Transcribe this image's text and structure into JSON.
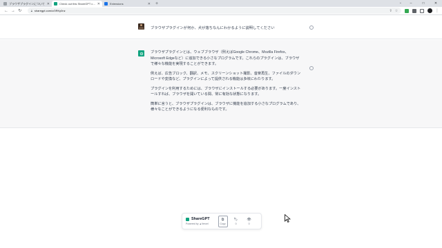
{
  "browser": {
    "tabs": [
      {
        "label": "ブラウザプラグインについて",
        "favicon_color": "#9aa0a6",
        "active": false
      },
      {
        "label": "Check out this ShareGPT conversation",
        "favicon_color": "#10a37f",
        "active": true
      },
      {
        "label": "Extensions",
        "favicon_color": "#1a73e8",
        "active": false
      }
    ],
    "new_tab_glyph": "+",
    "url": "sharegpt.com/c/0RKy0nz",
    "window_controls": [
      "–",
      "□",
      "✕"
    ]
  },
  "conversation": {
    "user_message": "ブラウザプラグインが何か、犬が落ちなんにわかるように説明してください",
    "assistant_paragraphs": [
      "ブラウザプラグインとは、ウェブブラウザ（例えばGoogle Chrome、Mozilla Firefox、Microsoft Edgeなど）に追加できる小さなプログラムです。これらのプラグインは、ブラウザで様々な機能を実現することができます。",
      "例えば、広告ブロック、翻訳、メモ、スクリーンショット撮影、音楽再生、ファイルのダウンロードや変換など、プラグインによって提供される機能は多岐にわたります。",
      "プラグインを利用するためには、ブラウザにインストールする必要があります。一度インストールすれば、ブラウザを開いている間、常に有効な状態になります。",
      "簡単に言うと、ブラウザプラグインは、ブラウザに機能を追加する小さなプログラムであり、様々なことができるようになる便利なものです。"
    ]
  },
  "footer": {
    "brand": "ShareGPT",
    "powered_by": "Powered by ▲Vercel",
    "actions": [
      {
        "icon": "copy-icon",
        "label": "Copy",
        "active": true
      },
      {
        "icon": "bookmark-icon",
        "label": "0",
        "active": false
      },
      {
        "icon": "eye-icon",
        "label": "0",
        "active": false
      }
    ]
  },
  "colors": {
    "accent": "#10a37f",
    "assistant_bg": "#f7f7f8"
  }
}
